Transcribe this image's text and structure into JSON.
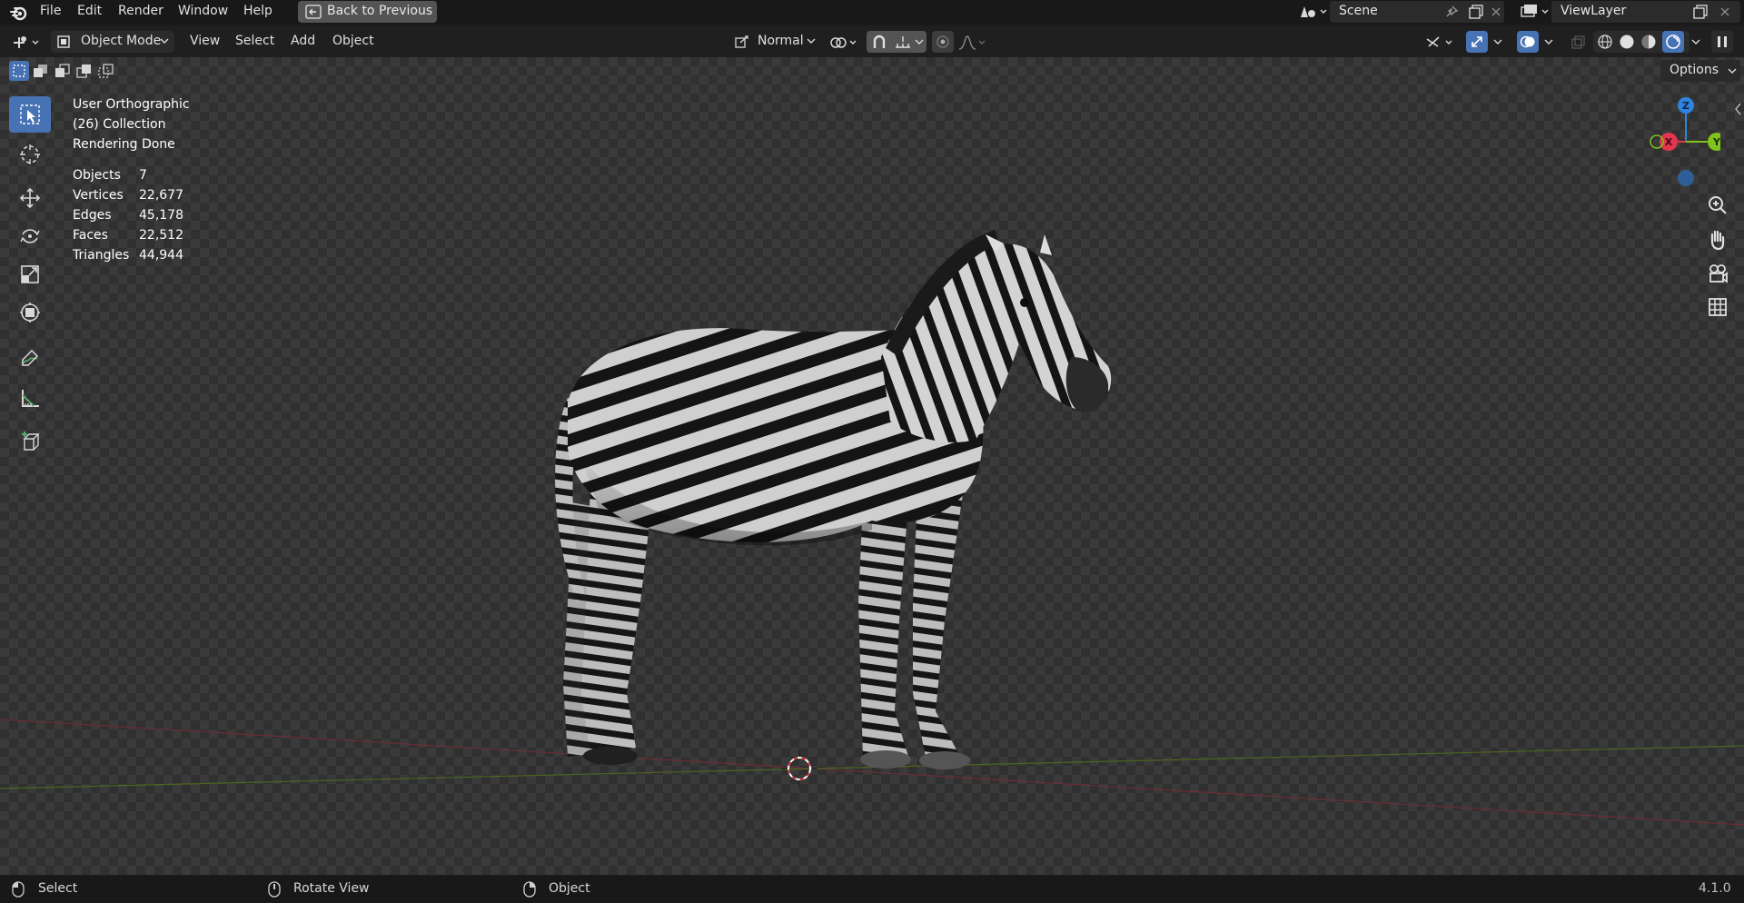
{
  "menu": {
    "file": "File",
    "edit": "Edit",
    "render": "Render",
    "window": "Window",
    "help": "Help",
    "back_to_previous": "Back to Previous"
  },
  "scene": {
    "value": "Scene"
  },
  "view_layer": {
    "value": "ViewLayer"
  },
  "header": {
    "mode": "Object Mode",
    "view": "View",
    "select": "Select",
    "add": "Add",
    "object": "Object",
    "orientation": "Normal",
    "options": "Options"
  },
  "overlay_info": {
    "view_name": "User Orthographic",
    "collection": "(26) Collection",
    "render_status": "Rendering Done"
  },
  "stats": [
    {
      "label": "Objects",
      "value": "7"
    },
    {
      "label": "Vertices",
      "value": "22,677"
    },
    {
      "label": "Edges",
      "value": "45,178"
    },
    {
      "label": "Faces",
      "value": "22,512"
    },
    {
      "label": "Triangles",
      "value": "44,944"
    }
  ],
  "gizmo": {
    "x": "X",
    "y": "Y",
    "z": "Z"
  },
  "statusbar": {
    "select": "Select",
    "rotate": "Rotate View",
    "object": "Object",
    "version": "4.1.0"
  },
  "colors": {
    "accent": "#4772b3",
    "x_axis": "#e2364e",
    "y_axis": "#7fc31c",
    "z_axis": "#2f83e0"
  }
}
